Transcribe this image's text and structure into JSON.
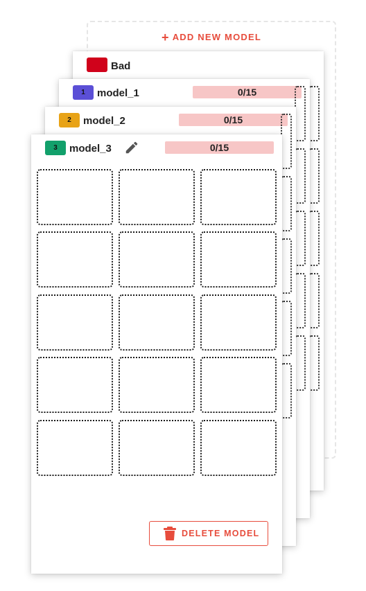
{
  "add_model": {
    "icon": "plus-icon",
    "label": "ADD NEW MODEL"
  },
  "models": [
    {
      "name": "Bad",
      "badge": "",
      "badge_color": "#d0021b"
    },
    {
      "name": "model_1",
      "badge": "1",
      "badge_color": "#5b4fd6",
      "count": "0/15"
    },
    {
      "name": "model_2",
      "badge": "2",
      "badge_color": "#e8a317",
      "count": "0/15"
    },
    {
      "name": "model_3",
      "badge": "3",
      "badge_color": "#12a06b",
      "count": "0/15",
      "edit_icon": "pencil-icon"
    }
  ],
  "delete_button": {
    "icon": "trash-icon",
    "label": "DELETE MODEL"
  },
  "colors": {
    "accent": "#e74c3c",
    "counter_bg": "#f7c6c6"
  }
}
